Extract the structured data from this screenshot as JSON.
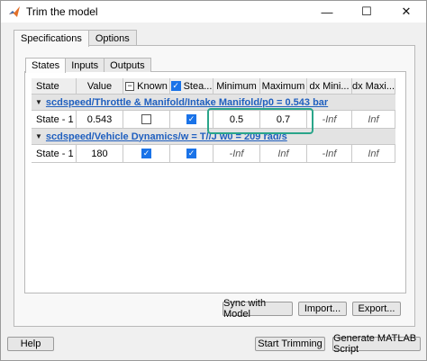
{
  "window": {
    "title": "Trim the model",
    "minimize": "—",
    "maximize": "☐",
    "close": "✕"
  },
  "outer_tabs": [
    "Specifications",
    "Options"
  ],
  "inner_tabs": [
    "States",
    "Inputs",
    "Outputs"
  ],
  "table": {
    "headers": {
      "state": "State",
      "value": "Value",
      "known": "Known",
      "steady": "Stea...",
      "minimum": "Minimum",
      "maximum": "Maximum",
      "dx_min": "dx Mini...",
      "dx_max": "dx Maxi..."
    },
    "groups": [
      {
        "title": "scdspeed/Throttle & Manifold/Intake Manifold/p0 = 0.543 bar",
        "row": {
          "state": "State - 1",
          "value": "0.543",
          "known": false,
          "steady": true,
          "minimum": "0.5",
          "maximum": "0.7",
          "dx_min": "-Inf",
          "dx_max": "Inf"
        }
      },
      {
        "title": "scdspeed/Vehicle Dynamics/w = T//J w0 = 209 rad/s",
        "row": {
          "state": "State - 1",
          "value": "180",
          "known": true,
          "steady": true,
          "minimum": "-Inf",
          "maximum": "Inf",
          "dx_min": "-Inf",
          "dx_max": "Inf"
        }
      }
    ]
  },
  "buttons": {
    "sync": "Sync with Model",
    "import": "Import...",
    "export": "Export...",
    "help": "Help",
    "start": "Start Trimming",
    "generate": "Generate MATLAB Script"
  },
  "colors": {
    "highlight": "#2aa58a",
    "link": "#1f5fbf",
    "checkbox": "#1a73e8"
  }
}
